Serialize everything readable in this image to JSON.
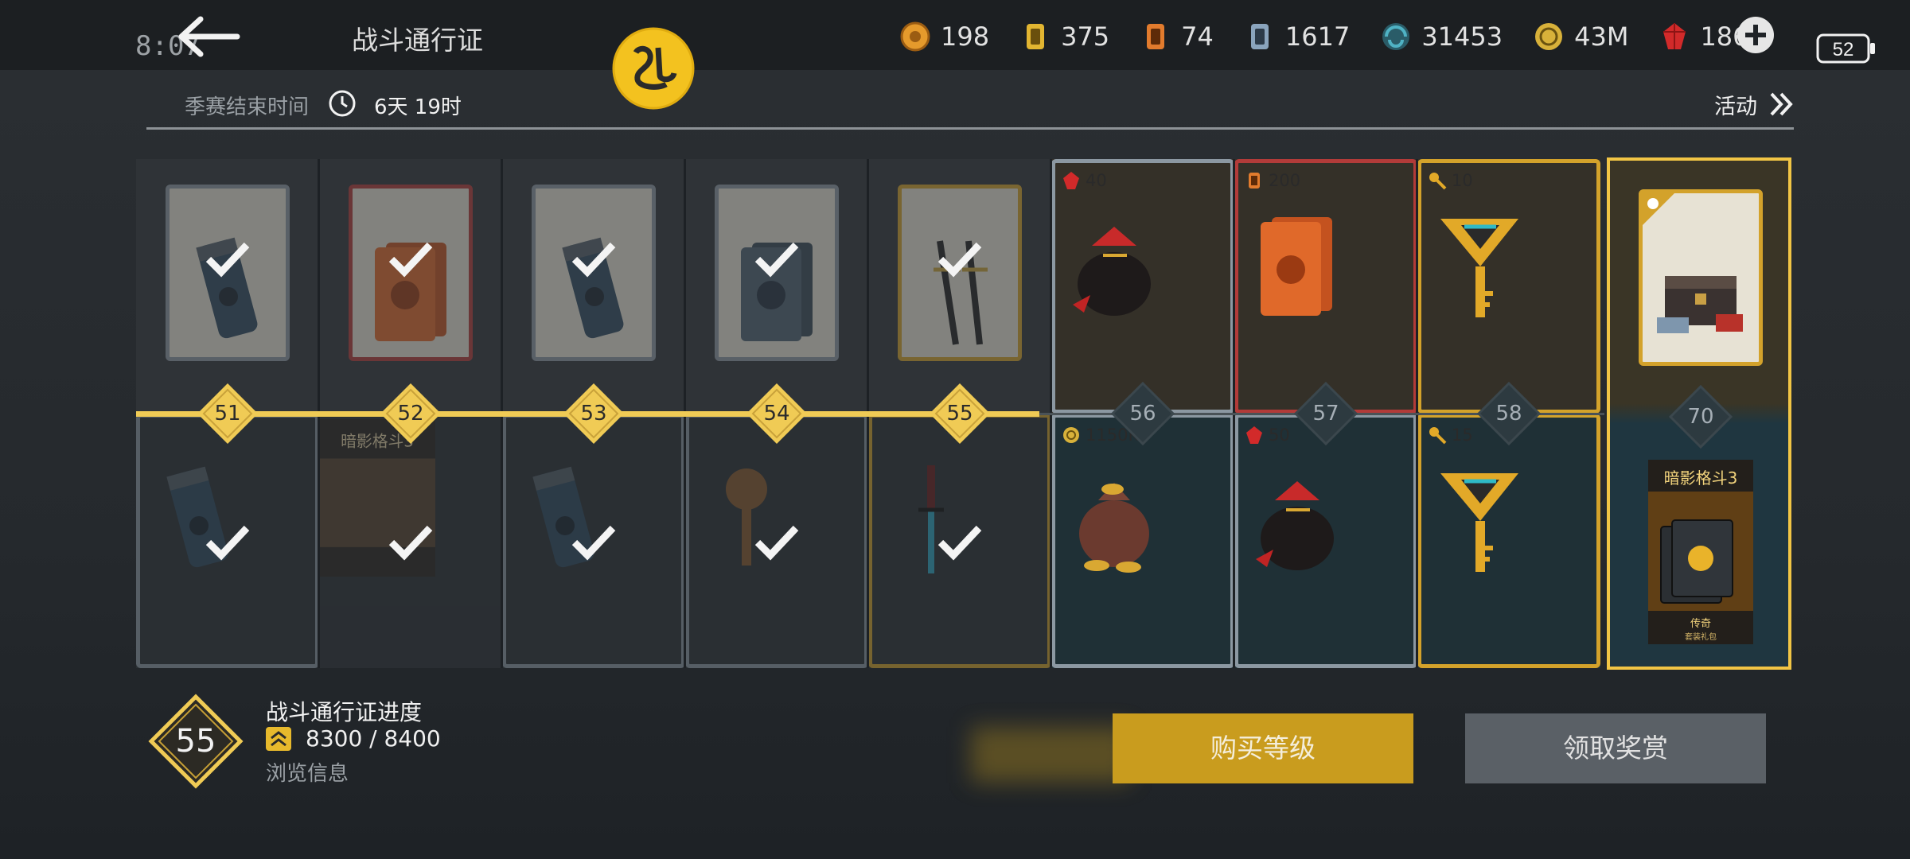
{
  "status": {
    "time": "8:07",
    "battery": "52"
  },
  "header": {
    "title": "战斗通行证"
  },
  "currencies": [
    {
      "icon": "orange-token-icon",
      "value": "198",
      "color": "#e59a2c"
    },
    {
      "icon": "gold-card-icon",
      "value": "375",
      "color": "#e2b531"
    },
    {
      "icon": "orange-card-icon",
      "value": "74",
      "color": "#e27b2d"
    },
    {
      "icon": "blue-card-icon",
      "value": "1617",
      "color": "#8aa4bd"
    },
    {
      "icon": "blue-swirl-icon",
      "value": "31453",
      "color": "#4fb2c4"
    },
    {
      "icon": "gold-coin-icon",
      "value": "43M",
      "color": "#d8b13a"
    },
    {
      "icon": "red-gem-icon",
      "value": "186",
      "color": "#d22a2a"
    }
  ],
  "season": {
    "label": "季赛结束时间",
    "remaining": "6天 19时"
  },
  "activity": {
    "label": "活动"
  },
  "levels": [
    {
      "level": "51",
      "claimed": true,
      "free": {
        "icon": "cylinder-capsule-icon",
        "frame": "blue",
        "amount": ""
      },
      "premium": {
        "icon": "cylinder-capsule-icon",
        "frame": "blue",
        "amount": ""
      }
    },
    {
      "level": "52",
      "claimed": true,
      "free": {
        "icon": "orange-card-pack-icon",
        "frame": "red",
        "amount": ""
      },
      "premium": {
        "icon": "game-poster-icon",
        "frame": "none",
        "amount": ""
      }
    },
    {
      "level": "53",
      "claimed": true,
      "free": {
        "icon": "cylinder-capsule-icon",
        "frame": "blue",
        "amount": ""
      },
      "premium": {
        "icon": "cylinder-capsule-icon",
        "frame": "blue",
        "amount": ""
      }
    },
    {
      "level": "54",
      "claimed": true,
      "free": {
        "icon": "blue-card-pack-icon",
        "frame": "blue",
        "amount": ""
      },
      "premium": {
        "icon": "bronze-key-icon",
        "frame": "blue",
        "amount": ""
      }
    },
    {
      "level": "55",
      "claimed": true,
      "free": {
        "icon": "twin-swords-icon",
        "frame": "gold",
        "amount": ""
      },
      "premium": {
        "icon": "katana-icon",
        "frame": "gold",
        "amount": ""
      }
    },
    {
      "level": "56",
      "claimed": false,
      "free": {
        "icon": "gem-sack-icon",
        "frame": "blue",
        "amount": "40",
        "amount_icon": "red-gem-icon"
      },
      "premium": {
        "icon": "coin-sack-icon",
        "frame": "blue",
        "amount": "1150K",
        "amount_icon": "gold-coin-icon"
      }
    },
    {
      "level": "57",
      "claimed": false,
      "free": {
        "icon": "orange-card-pack-icon",
        "frame": "red",
        "amount": "200",
        "amount_icon": "orange-card-icon"
      },
      "premium": {
        "icon": "gem-sack-icon",
        "frame": "blue",
        "amount": "50",
        "amount_icon": "red-gem-icon"
      }
    },
    {
      "level": "58",
      "claimed": false,
      "free": {
        "icon": "gold-key-icon",
        "frame": "gold",
        "amount": "10",
        "amount_icon": "key-icon"
      },
      "premium": {
        "icon": "gold-key-icon",
        "frame": "gold",
        "amount": "15",
        "amount_icon": "key-icon"
      }
    }
  ],
  "final_reward": {
    "level": "70",
    "top_icon": "treasure-chest-icon",
    "bottom_icon": "legendary-pack-icon"
  },
  "progress": {
    "level": "55",
    "title": "战斗通行证进度",
    "value": "8300 / 8400",
    "browse": "浏览信息"
  },
  "buttons": {
    "buy": "购买等级",
    "claim": "领取奖赏"
  },
  "colors": {
    "accent": "#f0cb55",
    "buy_button": "#c99c1e",
    "claim_button": "#5a6066",
    "gem": "#d22a2a"
  }
}
